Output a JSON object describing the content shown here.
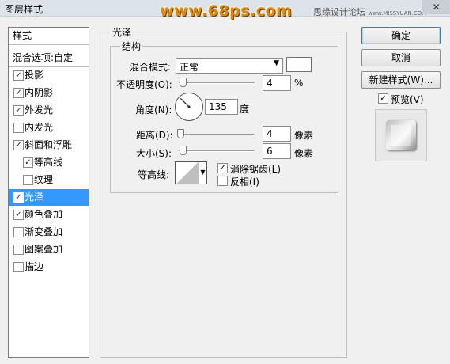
{
  "window": {
    "title": "图层样式",
    "close_label": "✕"
  },
  "watermark": {
    "main": "www.68ps.com",
    "secondary": "思缘设计论坛",
    "secondary_site": "www.MISSYUAN.COM"
  },
  "style_list": {
    "header": "样式",
    "blend_options": "混合选项:自定",
    "items": [
      {
        "label": "投影",
        "checked": true
      },
      {
        "label": "内阴影",
        "checked": true
      },
      {
        "label": "外发光",
        "checked": true
      },
      {
        "label": "内发光",
        "checked": false
      },
      {
        "label": "斜面和浮雕",
        "checked": true
      },
      {
        "label": "等高线",
        "checked": true
      },
      {
        "label": "纹理",
        "checked": false
      },
      {
        "label": "光泽",
        "checked": true
      },
      {
        "label": "颜色叠加",
        "checked": true
      },
      {
        "label": "渐变叠加",
        "checked": false
      },
      {
        "label": "图案叠加",
        "checked": false
      },
      {
        "label": "描边",
        "checked": false
      }
    ]
  },
  "satin": {
    "group_title": "光泽",
    "structure_title": "结构",
    "blend_mode_label": "混合模式:",
    "blend_mode_value": "正常",
    "blend_color": "#ffffff",
    "opacity_label": "不透明度(O):",
    "opacity_value": "4",
    "opacity_unit": "%",
    "angle_label": "角度(N):",
    "angle_value": "135",
    "angle_unit": "度",
    "distance_label": "距离(D):",
    "distance_value": "4",
    "distance_unit": "像素",
    "size_label": "大小(S):",
    "size_value": "6",
    "size_unit": "像素",
    "contour_label": "等高线:",
    "anti_alias_label": "消除锯齿(L)",
    "anti_alias_checked": true,
    "invert_label": "反相(I)",
    "invert_checked": false
  },
  "buttons": {
    "ok": "确定",
    "cancel": "取消",
    "new_style": "新建样式(W)...",
    "preview_label": "预览(V)",
    "preview_checked": true
  },
  "colors": {
    "selection": "#3399ff",
    "watermark": "#d98a12"
  }
}
